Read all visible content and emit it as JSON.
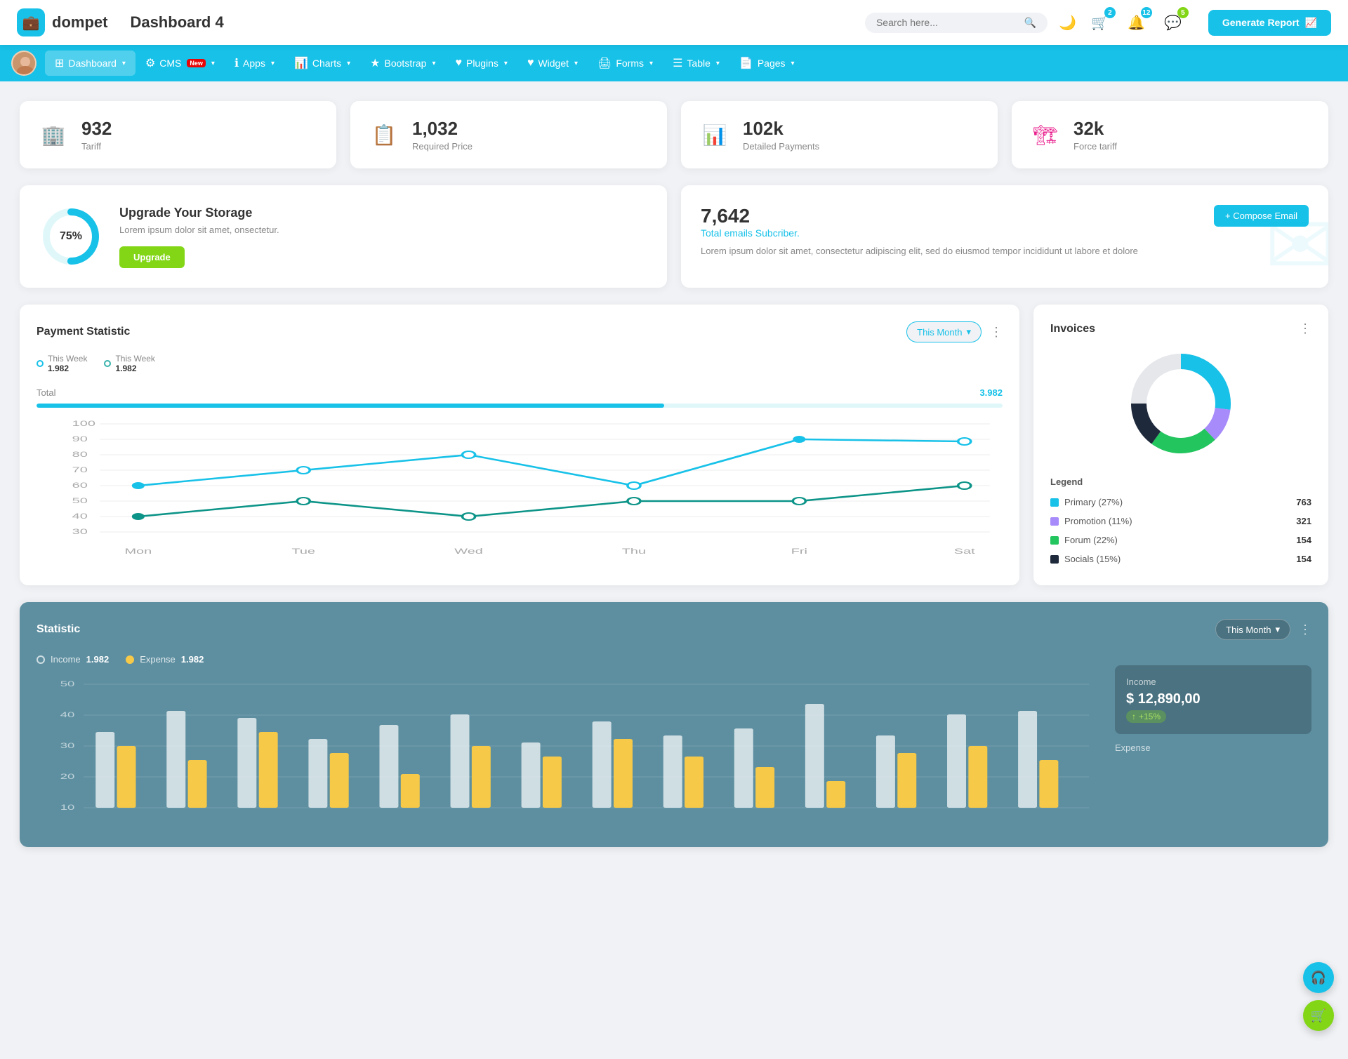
{
  "header": {
    "logo_text": "dompet",
    "page_title": "Dashboard 4",
    "search_placeholder": "Search here...",
    "btn_generate": "Generate Report",
    "badges": {
      "cart": "2",
      "bell": "12",
      "chat": "5"
    }
  },
  "nav": {
    "items": [
      {
        "id": "dashboard",
        "label": "Dashboard",
        "icon": "⊞",
        "active": true,
        "has_arrow": true
      },
      {
        "id": "cms",
        "label": "CMS",
        "icon": "⚙",
        "badge": "New",
        "active": false,
        "has_arrow": true
      },
      {
        "id": "apps",
        "label": "Apps",
        "icon": "ℹ",
        "active": false,
        "has_arrow": true
      },
      {
        "id": "charts",
        "label": "Charts",
        "icon": "📊",
        "active": false,
        "has_arrow": true
      },
      {
        "id": "bootstrap",
        "label": "Bootstrap",
        "icon": "★",
        "active": false,
        "has_arrow": true
      },
      {
        "id": "plugins",
        "label": "Plugins",
        "icon": "♥",
        "active": false,
        "has_arrow": true
      },
      {
        "id": "widget",
        "label": "Widget",
        "icon": "♥",
        "active": false,
        "has_arrow": true
      },
      {
        "id": "forms",
        "label": "Forms",
        "icon": "🖨",
        "active": false,
        "has_arrow": true
      },
      {
        "id": "table",
        "label": "Table",
        "icon": "☰",
        "active": false,
        "has_arrow": true
      },
      {
        "id": "pages",
        "label": "Pages",
        "icon": "📄",
        "active": false,
        "has_arrow": true
      }
    ]
  },
  "stat_cards": [
    {
      "id": "tariff",
      "value": "932",
      "label": "Tariff",
      "icon": "🏢",
      "color": "teal"
    },
    {
      "id": "required_price",
      "value": "1,032",
      "label": "Required Price",
      "icon": "📋",
      "color": "red"
    },
    {
      "id": "detailed_payments",
      "value": "102k",
      "label": "Detailed Payments",
      "icon": "📊",
      "color": "purple"
    },
    {
      "id": "force_tariff",
      "value": "32k",
      "label": "Force tariff",
      "icon": "🏗",
      "color": "pink"
    }
  ],
  "storage": {
    "percent": "75%",
    "title": "Upgrade Your Storage",
    "desc": "Lorem ipsum dolor sit amet, onsectetur.",
    "btn_label": "Upgrade"
  },
  "email": {
    "count": "7,642",
    "sub_label": "Total emails Subcriber.",
    "desc": "Lorem ipsum dolor sit amet, consectetur adipiscing elit, sed do eiusmod tempor incididunt ut labore et dolore",
    "btn_label": "+ Compose Email"
  },
  "payment": {
    "title": "Payment Statistic",
    "filter_label": "This Month",
    "legend": [
      {
        "id": "this_week_1",
        "label": "This Week",
        "value": "1.982"
      },
      {
        "id": "this_week_2",
        "label": "This Week",
        "value": "1.982"
      }
    ],
    "total_label": "Total",
    "total_value": "3.982",
    "progress_pct": 65,
    "x_labels": [
      "Mon",
      "Tue",
      "Wed",
      "Thu",
      "Fri",
      "Sat"
    ],
    "y_labels": [
      "100",
      "90",
      "80",
      "70",
      "60",
      "50",
      "40",
      "30"
    ]
  },
  "invoices": {
    "title": "Invoices",
    "legend": [
      {
        "id": "primary",
        "label": "Primary (27%)",
        "value": "763",
        "color": "#17c1e8"
      },
      {
        "id": "promotion",
        "label": "Promotion (11%)",
        "value": "321",
        "color": "#a78bfa"
      },
      {
        "id": "forum",
        "label": "Forum (22%)",
        "value": "154",
        "color": "#22c55e"
      },
      {
        "id": "socials",
        "label": "Socials (15%)",
        "value": "154",
        "color": "#1e293b"
      }
    ]
  },
  "statistic": {
    "title": "Statistic",
    "filter_label": "This Month",
    "legend": [
      {
        "id": "income",
        "label": "Income",
        "value": "1.982",
        "color": "white"
      },
      {
        "id": "expense",
        "label": "Expense",
        "value": "1.982",
        "color": "yellow"
      }
    ],
    "income_panel": {
      "label": "Income",
      "value": "$ 12,890,00",
      "badge": "+15%"
    },
    "y_labels": [
      "50",
      "40",
      "30",
      "20",
      "10"
    ],
    "expense_label": "Expense"
  }
}
